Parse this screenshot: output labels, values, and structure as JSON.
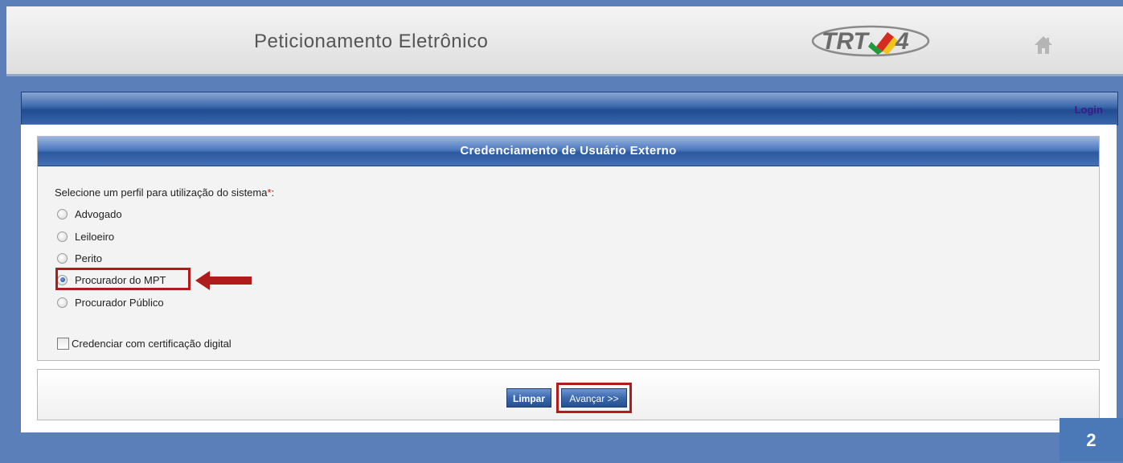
{
  "header": {
    "title": "Peticionamento Eletrônico",
    "logo_text": "TRT 4"
  },
  "navbar": {
    "login_label": "Login"
  },
  "form": {
    "title": "Credenciamento de Usuário Externo",
    "prompt": "Selecione um perfil para utilização do sistema",
    "required_marker": "*",
    "prompt_suffix": ":",
    "profiles": [
      {
        "label": "Advogado",
        "checked": false
      },
      {
        "label": "Leiloeiro",
        "checked": false
      },
      {
        "label": "Perito",
        "checked": false
      },
      {
        "label": "Procurador do MPT",
        "checked": true
      },
      {
        "label": "Procurador Público",
        "checked": false
      }
    ],
    "digital_cert_label": "Credenciar com certificação digital",
    "digital_cert_checked": false
  },
  "buttons": {
    "clear_label": "Limpar",
    "next_label": "Avançar >>"
  },
  "step_badge": "2",
  "icons": {
    "home": "home-icon",
    "arrow": "arrow-left-icon"
  },
  "colors": {
    "highlight": "#b01c1c",
    "accent": "#2c5aa0",
    "background": "#5b80b9"
  }
}
